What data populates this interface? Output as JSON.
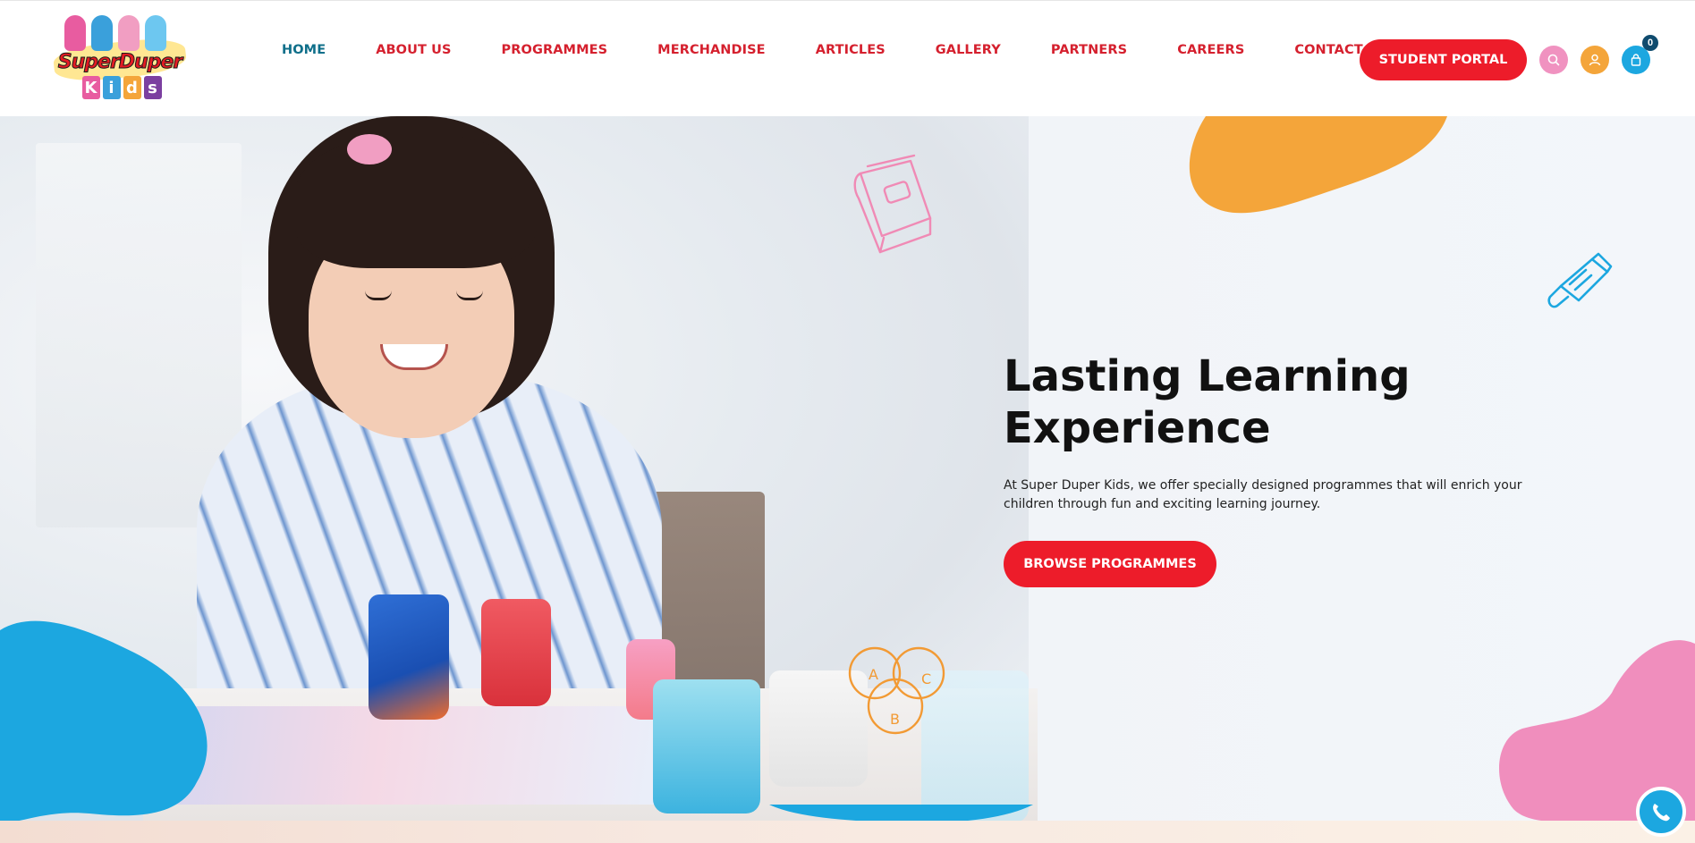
{
  "brand": {
    "logo_text_line1": "SuperDuper",
    "logo_text_line2": "Kids",
    "logo_letter_colors": [
      "#e85ca0",
      "#3aa0db",
      "#f4a53a",
      "#7b3fa0"
    ]
  },
  "nav": {
    "items": [
      {
        "label": "HOME",
        "active": true
      },
      {
        "label": "ABOUT US",
        "active": false
      },
      {
        "label": "PROGRAMMES",
        "active": false
      },
      {
        "label": "MERCHANDISE",
        "active": false
      },
      {
        "label": "ARTICLES",
        "active": false
      },
      {
        "label": "GALLERY",
        "active": false
      },
      {
        "label": "PARTNERS",
        "active": false
      },
      {
        "label": "CAREERS",
        "active": false
      },
      {
        "label": "CONTACT US",
        "active": false
      }
    ],
    "portal_label": "STUDENT PORTAL",
    "icons": {
      "search": "search-icon",
      "account": "user-icon",
      "cart": "shopping-bag-icon"
    },
    "cart_count": "0"
  },
  "hero": {
    "title": "Lasting Learning Experience",
    "description": "At Super Duper Kids, we offer specially designed programmes that will enrich your children through fun and exciting learning journey.",
    "cta_label": "BROWSE PROGRAMMES",
    "doodles": {
      "book": "book-doodle-icon",
      "paint_tube": "paint-tube-doodle-icon",
      "venn_abc": "abc-venn-doodle-icon"
    },
    "venn_letters": [
      "A",
      "C",
      "B"
    ]
  },
  "widgets": {
    "whatsapp_icon": "whatsapp-icon"
  },
  "colors": {
    "brand_red": "#ed1c2a",
    "nav_red": "#d5202e",
    "nav_active": "#0f6f8a",
    "pink": "#e85ca0",
    "orange": "#f4a53a",
    "blue": "#1ca7e0"
  }
}
